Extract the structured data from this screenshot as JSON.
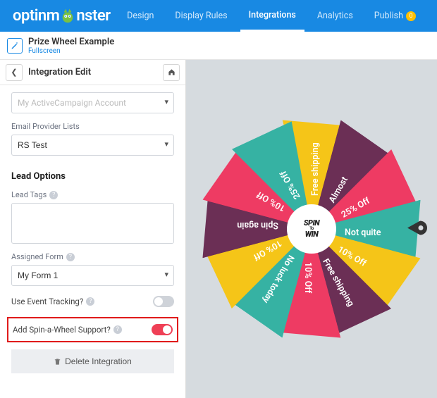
{
  "header": {
    "brand_pre": "optinm",
    "brand_post": "nster",
    "tabs": [
      {
        "label": "Design"
      },
      {
        "label": "Display Rules"
      },
      {
        "label": "Integrations"
      },
      {
        "label": "Analytics"
      },
      {
        "label": "Publish"
      }
    ],
    "publish_badge": "0"
  },
  "campaign": {
    "name": "Prize Wheel Example",
    "type": "Fullscreen"
  },
  "panel": {
    "title": "Integration Edit",
    "account_label": "My ActiveCampaign Account",
    "lists_label": "Email Provider Lists",
    "lists_value": "RS Test",
    "lead_section": "Lead Options",
    "tags_label": "Lead Tags",
    "form_label": "Assigned Form",
    "form_value": "My Form 1",
    "event_label": "Use Event Tracking?",
    "spin_label": "Add Spin-a-Wheel Support?",
    "delete_label": "Delete Integration"
  },
  "wheel": {
    "hub_line1": "SPIN",
    "hub_mid": "To",
    "hub_line2": "WIN",
    "slices": [
      {
        "label": "Free shipping",
        "color": "#f5c518"
      },
      {
        "label": "Almost",
        "color": "#6b2f55"
      },
      {
        "label": "25% Off",
        "color": "#ee3b63"
      },
      {
        "label": "Not quite",
        "color": "#36b2a3"
      },
      {
        "label": "10% Off",
        "color": "#f5c518"
      },
      {
        "label": "Free shipping",
        "color": "#6b2f55"
      },
      {
        "label": "10% Off",
        "color": "#ee3b63"
      },
      {
        "label": "No luck today",
        "color": "#36b2a3"
      },
      {
        "label": "10% Off",
        "color": "#f5c518"
      },
      {
        "label": "Spin again",
        "color": "#6b2f55"
      },
      {
        "label": "10% Off",
        "color": "#ee3b63"
      },
      {
        "label": "25% Off",
        "color": "#36b2a3"
      }
    ]
  }
}
